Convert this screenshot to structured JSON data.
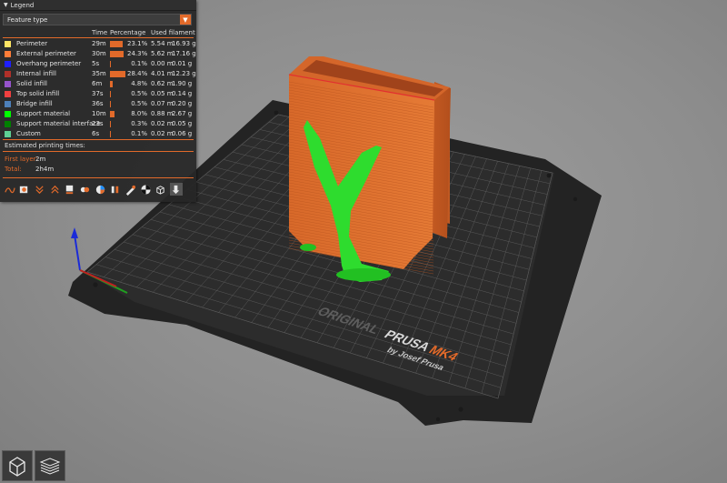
{
  "legend": {
    "title": "Legend",
    "view_type": "Feature type",
    "headers": {
      "time": "Time",
      "percentage": "Percentage",
      "filament": "Used filament"
    },
    "features": [
      {
        "name": "Perimeter",
        "time": "29m",
        "percentage": "23.1%",
        "length": "5.54 m",
        "weight": "16.93 g",
        "color": "#ffe564",
        "bar": 0.231
      },
      {
        "name": "External perimeter",
        "time": "30m",
        "percentage": "24.3%",
        "length": "5.62 m",
        "weight": "17.16 g",
        "color": "#ff7d38",
        "bar": 0.243
      },
      {
        "name": "Overhang perimeter",
        "time": "5s",
        "percentage": "0.1%",
        "length": "0.00 m",
        "weight": "0.01 g",
        "color": "#1f1fff",
        "bar": 0.001
      },
      {
        "name": "Internal infill",
        "time": "35m",
        "percentage": "28.4%",
        "length": "4.01 m",
        "weight": "12.23 g",
        "color": "#b03029",
        "bar": 0.284
      },
      {
        "name": "Solid infill",
        "time": "6m",
        "percentage": "4.8%",
        "length": "0.62 m",
        "weight": "1.90 g",
        "color": "#9654cc",
        "bar": 0.048
      },
      {
        "name": "Top solid infill",
        "time": "37s",
        "percentage": "0.5%",
        "length": "0.05 m",
        "weight": "0.14 g",
        "color": "#f04040",
        "bar": 0.005
      },
      {
        "name": "Bridge infill",
        "time": "36s",
        "percentage": "0.5%",
        "length": "0.07 m",
        "weight": "0.20 g",
        "color": "#4d80ba",
        "bar": 0.005
      },
      {
        "name": "Support material",
        "time": "10m",
        "percentage": "8.0%",
        "length": "0.88 m",
        "weight": "2.67 g",
        "color": "#00ff00",
        "bar": 0.08
      },
      {
        "name": "Support material interface",
        "time": "23s",
        "percentage": "0.3%",
        "length": "0.02 m",
        "weight": "0.05 g",
        "color": "#008000",
        "bar": 0.003
      },
      {
        "name": "Custom",
        "time": "6s",
        "percentage": "0.1%",
        "length": "0.02 m",
        "weight": "0.06 g",
        "color": "#5ed194",
        "bar": 0.001
      }
    ],
    "estimated_title": "Estimated printing times:",
    "first_layer_label": "First layer:",
    "first_layer_value": "2m",
    "total_label": "Total:",
    "total_value": "2h4m"
  },
  "toolbar_icons": [
    "travel-icon",
    "wipe-icon",
    "retractions-icon",
    "deretractions-icon",
    "seams-icon",
    "tool-changes-icon",
    "color-changes-icon",
    "pause-prints-icon",
    "custom-gcodes-icon",
    "center-of-gravity-icon",
    "shells-icon",
    "tool-marker-icon"
  ],
  "bed": {
    "brand": "ORIGINAL",
    "model": "PRUSA",
    "version": "MK4",
    "byline": "by Josef Prusa"
  },
  "colors": {
    "accent": "#e26a2a",
    "model": "#e0742e",
    "support": "#2ee12e",
    "bed": "#2d2d2d"
  },
  "view_buttons": [
    "3d-view-icon",
    "layers-preview-icon"
  ]
}
